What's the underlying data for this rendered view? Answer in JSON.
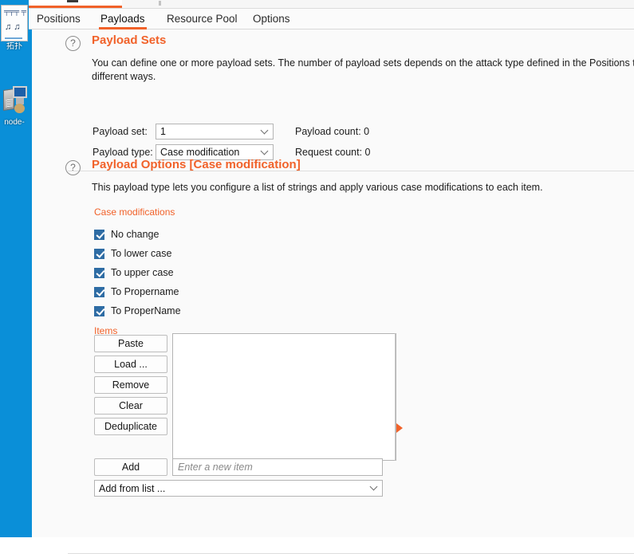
{
  "desktop": {
    "icons": [
      {
        "name": "topology-shortcut",
        "caption": "拓扑",
        "thumb_top": "╤╤╤ ╤",
        "thumb_mid": "♫ ♫"
      },
      {
        "name": "node-shortcut",
        "caption": "node-"
      }
    ]
  },
  "window": {
    "tabs": [
      {
        "id": "positions",
        "label": "Positions",
        "active": false
      },
      {
        "id": "payloads",
        "label": "Payloads",
        "active": true
      },
      {
        "id": "resource_pool",
        "label": "Resource Pool",
        "active": false
      },
      {
        "id": "options",
        "label": "Options",
        "active": false
      }
    ],
    "accent_color": "#f1622a",
    "rail_color": "#0a8fd8"
  },
  "payload_sets": {
    "help_icon": "?",
    "title": "Payload Sets",
    "description_line1": "You can define one or more payload sets. The number of payload sets depends on the attack type defined in the Positions tab. Various pa",
    "description_line2": "different ways.",
    "payload_set_label": "Payload set:",
    "payload_set_value": "1",
    "payload_set_options": [
      "1"
    ],
    "payload_type_label": "Payload type:",
    "payload_type_value": "Case modification",
    "payload_type_options": [
      "Case modification"
    ],
    "payload_count_label": "Payload count:  0",
    "request_count_label": "Request count:  0"
  },
  "payload_options": {
    "help_icon": "?",
    "title": "Payload Options [Case modification]",
    "description": "This payload type lets you configure a list of strings and apply various case modifications to each item.",
    "case_modifications_label": "Case modifications",
    "case_modifications": [
      {
        "label": "No change",
        "checked": true
      },
      {
        "label": "To lower case",
        "checked": true
      },
      {
        "label": "To upper case",
        "checked": true
      },
      {
        "label": "To Propername",
        "checked": true
      },
      {
        "label": "To ProperName",
        "checked": true
      }
    ],
    "items_label": "Items",
    "buttons": {
      "paste": "Paste",
      "load": "Load ...",
      "remove": "Remove",
      "clear": "Clear",
      "deduplicate": "Deduplicate",
      "add": "Add"
    },
    "items_list": [],
    "new_item_placeholder": "Enter a new item",
    "new_item_value": "",
    "add_from_list_value": "Add from list ...",
    "add_from_list_options": [
      "Add from list ..."
    ],
    "marker_icon": "play-triangle"
  }
}
